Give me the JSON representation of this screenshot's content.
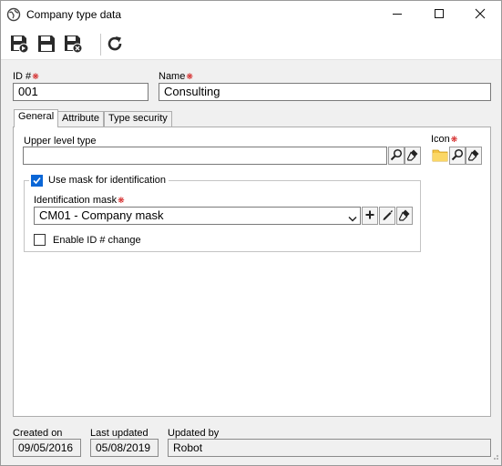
{
  "window": {
    "title": "Company type data",
    "controls": [
      "minimize",
      "maximize",
      "close"
    ],
    "icon": "gear-globe-icon"
  },
  "toolbar": {
    "buttons": [
      {
        "name": "save-and-new-button",
        "icon": "save-plus-icon"
      },
      {
        "name": "save-button",
        "icon": "save-icon"
      },
      {
        "name": "save-and-close-button",
        "icon": "save-close-icon"
      },
      {
        "name": "refresh-button",
        "icon": "refresh-icon"
      }
    ]
  },
  "form": {
    "id_label": "ID #",
    "id_value": "001",
    "name_label": "Name",
    "name_value": "Consulting"
  },
  "tabs": [
    {
      "label": "General",
      "active": true
    },
    {
      "label": "Attribute",
      "active": false
    },
    {
      "label": "Type security",
      "active": false
    }
  ],
  "general": {
    "upper_level_label": "Upper level type",
    "upper_level_value": "",
    "icon_label": "Icon",
    "use_mask_label": "Use mask for identification",
    "use_mask_checked": true,
    "mask_label": "Identification mask",
    "mask_value": "CM01 - Company mask",
    "enable_id_change_label": "Enable ID # change",
    "enable_id_change_checked": false
  },
  "footer": {
    "created_on_label": "Created on",
    "created_on_value": "09/05/2016",
    "last_updated_label": "Last updated",
    "last_updated_value": "05/08/2019",
    "updated_by_label": "Updated by",
    "updated_by_value": "Robot"
  },
  "colors": {
    "required": "#d01010",
    "checkbox_accent": "#0a66d6",
    "window_bg": "#f0f0f0"
  }
}
